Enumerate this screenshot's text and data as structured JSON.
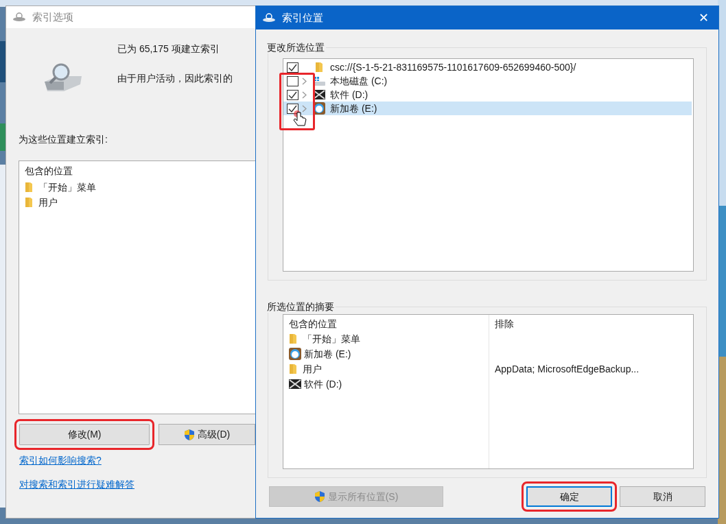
{
  "back_window": {
    "title": "索引选项",
    "indexed_count": "已为 65,175 项建立索引",
    "status_text": "由于用户活动，因此索引的",
    "locations_label": "为这些位置建立索引:",
    "list_header": "包含的位置",
    "locations": [
      {
        "kind": "folder",
        "label": "「开始」菜单"
      },
      {
        "kind": "folder",
        "label": "用户"
      }
    ],
    "buttons": [
      {
        "label": "修改(M)",
        "shield": false,
        "highlighted": true
      },
      {
        "label": "高级(D)",
        "shield": true,
        "highlighted": false
      }
    ],
    "links": [
      "索引如何影响搜索?",
      "对搜索和索引进行疑难解答"
    ]
  },
  "dialog": {
    "title": "索引位置",
    "close": "✕",
    "change_group": "更改所选位置",
    "tree": [
      {
        "checked": true,
        "expandable": false,
        "kind": "folder",
        "label": "csc://{S-1-5-21-831169575-1101617609-652699460-500}/",
        "selected": false
      },
      {
        "checked": false,
        "expandable": true,
        "kind": "windows-drive",
        "label": "本地磁盘 (C:)",
        "selected": false
      },
      {
        "checked": true,
        "expandable": true,
        "kind": "dark-drive",
        "label": "软件 (D:)",
        "selected": false
      },
      {
        "checked": true,
        "expandable": true,
        "kind": "avatar-drive",
        "label": "新加卷 (E:)",
        "selected": true
      }
    ],
    "summary_group": "所选位置的摘要",
    "summary_columns": [
      "包含的位置",
      "排除"
    ],
    "summary_rows": [
      {
        "kind": "folder",
        "label": "「开始」菜单"
      },
      {
        "kind": "avatar-drive",
        "label": "新加卷 (E:)"
      },
      {
        "kind": "folder",
        "label": "用户",
        "exclude": "AppData; MicrosoftEdgeBackup..."
      },
      {
        "kind": "dark-drive",
        "label": "软件 (D:)"
      }
    ],
    "buttons": [
      {
        "label": "显示所有位置(S)",
        "shield": true,
        "disabled": true,
        "default": false,
        "highlighted": false
      },
      {
        "label": "确定",
        "shield": false,
        "disabled": false,
        "default": true,
        "highlighted": true
      },
      {
        "label": "取消",
        "shield": false,
        "disabled": false,
        "default": false,
        "highlighted": false
      }
    ]
  }
}
